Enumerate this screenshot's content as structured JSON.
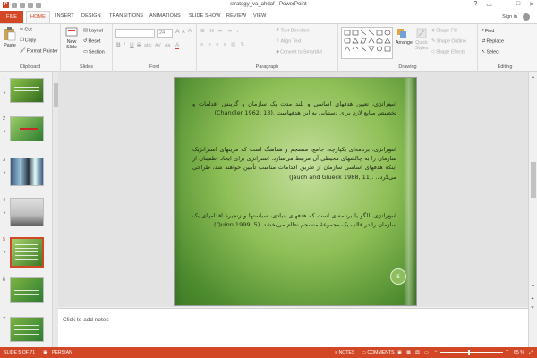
{
  "window": {
    "title": "strategy_va_ahdaf - PowerPoint",
    "controls": [
      "?",
      "▭",
      "—",
      "□",
      "✕"
    ]
  },
  "ribbon_tabs": [
    "FILE",
    "HOME",
    "INSERT",
    "DESIGN",
    "TRANSITIONS",
    "ANIMATIONS",
    "SLIDE SHOW",
    "REVIEW",
    "VIEW"
  ],
  "account": {
    "sign_in": "Sign in"
  },
  "ribbon": {
    "clipboard": {
      "label": "Clipboard",
      "paste": "Paste",
      "cut": "Cut",
      "copy": "Copy",
      "format_painter": "Format Painter"
    },
    "slides": {
      "label": "Slides",
      "new_slide_1": "New",
      "new_slide_2": "Slide",
      "layout": "Layout",
      "reset": "Reset",
      "section": "Section"
    },
    "font": {
      "label": "Font",
      "size_value": "24",
      "bold": "B",
      "italic": "I",
      "underline": "U",
      "strike": "S",
      "shadow": "abc",
      "spacing": "AV",
      "case": "Aa",
      "font_color": "A",
      "grow": "A",
      "shrink": "A",
      "clear": "A"
    },
    "paragraph": {
      "label": "Paragraph",
      "text_direction": "Text Direction",
      "align_text": "Align Text",
      "smartart": "Convert to SmartArt"
    },
    "drawing": {
      "label": "Drawing",
      "arrange": "Arrange",
      "quick_styles_1": "Quick",
      "quick_styles_2": "Styles",
      "shape_fill": "Shape Fill",
      "shape_outline": "Shape Outline",
      "shape_effects": "Shape Effects"
    },
    "editing": {
      "label": "Editing",
      "find": "Find",
      "replace": "Replace",
      "select": "Select"
    }
  },
  "slide_panel": {
    "thumbnails": [
      {
        "num": "1",
        "star": "*"
      },
      {
        "num": "2",
        "star": "*"
      },
      {
        "num": "3",
        "star": "*"
      },
      {
        "num": "4",
        "star": "*"
      },
      {
        "num": "5",
        "star": "*"
      },
      {
        "num": "6",
        "star": ""
      },
      {
        "num": "7",
        "star": ""
      }
    ],
    "selected": 5
  },
  "slide": {
    "paragraphs": [
      {
        "bullet": "o",
        "text": "استراتژی، تعیین هدفهای اساسی و بلند مدت یک سازمان و گزینش اقدامات و تخصیص منابع لازم برای دستیابی به این هدفهاست",
        "citation": "(Chandler 1962, 13)."
      },
      {
        "bullet": "o",
        "text": "استراتژی، برنامه‌ای یکپارچه، جامع، منسجم و هماهنگ است که مزیتهای استراتژیک سازمان را به چالشهای محیطی آن مرتبط می‌سازد. استراتژی برای ایجاد اطمینان از اینکه هدفهای اساسی سازمان از طریق اقدامات مناسب تأمین خواهند شد، طراحی می‌گردد.",
        "citation": "(Jauch and Glueck 1988, 11)."
      },
      {
        "bullet": "o",
        "text": "استراتژی، الگو یا برنامه‌ای است که هدفهای بنیادی، سیاستها و زنجیرۀ اقدامهای یک سازمان را در قالب یک مجموعۀ منسجم نظام می‌بخشد",
        "citation": "(Quinn 1999, 5)."
      }
    ],
    "page_number": "5"
  },
  "notes": {
    "placeholder": "Click to add notes"
  },
  "status": {
    "slide_of": "SLIDE 5 OF 71",
    "language": "PERSIAN",
    "notes": "NOTES",
    "comments": "COMMENTS",
    "zoom": "65 %",
    "zoom_minus": "−",
    "zoom_plus": "+"
  },
  "colors": {
    "accent": "#d24726",
    "slide_green": "#6fa63f"
  }
}
